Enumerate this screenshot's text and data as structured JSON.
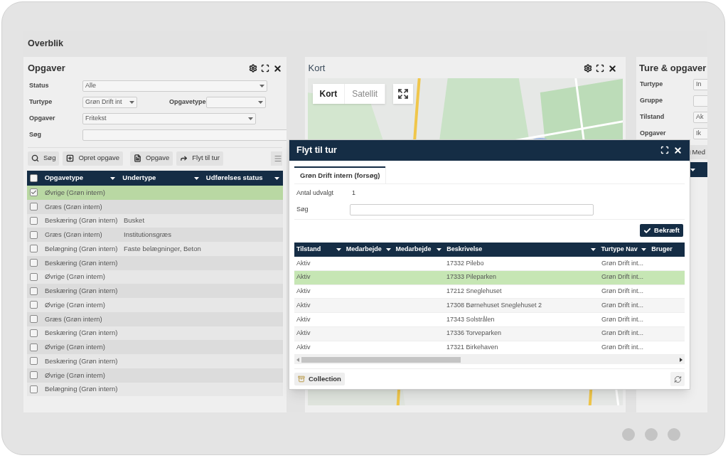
{
  "screen_title": "Overblik",
  "tasks_panel": {
    "title": "Opgaver",
    "filter_rows": [
      {
        "fields": [
          {
            "label": "Status",
            "value": "Alle",
            "kind": "select"
          }
        ]
      },
      {
        "fields": [
          {
            "label": "Turtype",
            "value": "Grøn Drift int",
            "kind": "select"
          },
          {
            "label": "Opgavetype",
            "kind": "select"
          }
        ]
      },
      {
        "fields": [
          {
            "label": "Opgaver",
            "value": "Fritekst",
            "kind": "select"
          }
        ]
      },
      {
        "fields": [
          {
            "label": "Søg",
            "kind": "text"
          }
        ]
      }
    ],
    "toolbar": [
      "Søg",
      "Opret opgave",
      "Opgave",
      "Flyt til tur"
    ],
    "columns": [
      "Opgavetype",
      "Undertype",
      "Udførelses status"
    ],
    "all_checked": false,
    "rows": [
      {
        "opgavetype": "Øvrige (Grøn intern)",
        "checked": true,
        "selected": true
      },
      {
        "opgavetype": "Græs (Grøn intern)",
        "checked": false,
        "selected": false
      },
      {
        "opgavetype": "Beskæring (Grøn intern)",
        "undertype": "Busket",
        "checked": false,
        "selected": false
      },
      {
        "opgavetype": "Græs (Grøn intern)",
        "undertype": "Institutionsgræs",
        "checked": false,
        "selected": false
      },
      {
        "opgavetype": "Belægning (Grøn intern)",
        "undertype": "Faste belægninger, Beton",
        "checked": false,
        "selected": false
      },
      {
        "opgavetype": "Beskæring (Grøn intern)",
        "checked": false,
        "selected": false
      },
      {
        "opgavetype": "Øvrige (Grøn intern)",
        "checked": false,
        "selected": false
      },
      {
        "opgavetype": "Beskæring (Grøn intern)",
        "checked": false,
        "selected": false
      },
      {
        "opgavetype": "Øvrige (Grøn intern)",
        "checked": false,
        "selected": false
      },
      {
        "opgavetype": "Græs (Grøn intern)",
        "checked": false,
        "selected": false
      },
      {
        "opgavetype": "Beskæring (Grøn intern)",
        "checked": false,
        "selected": false
      },
      {
        "opgavetype": "Øvrige (Grøn intern)",
        "checked": false,
        "selected": false
      },
      {
        "opgavetype": "Beskæring (Grøn intern)",
        "checked": false,
        "selected": false
      },
      {
        "opgavetype": "Øvrige (Grøn intern)",
        "checked": false,
        "selected": false
      },
      {
        "opgavetype": "Belægning (Grøn intern)",
        "checked": false,
        "selected": false
      }
    ]
  },
  "map_panel": {
    "title": "Kort",
    "map_types": [
      {
        "label": "Kort",
        "selected": true
      },
      {
        "label": "Satellit",
        "selected": false
      }
    ]
  },
  "trips_panel": {
    "title": "Ture & opgaver",
    "filters": [
      {
        "label": "Turtype",
        "value": "In"
      },
      {
        "label": "Gruppe"
      },
      {
        "label": "Tilstand",
        "value": "Ak"
      },
      {
        "label": "Opgaver",
        "value": "Ik"
      }
    ],
    "toolbar": [
      "Med"
    ]
  },
  "dialog": {
    "title": "Flyt til tur",
    "tabs": [
      {
        "label": "Grøn Drift intern (forsøg)",
        "selected": true
      }
    ],
    "count_label": "Antal udvalgt",
    "count_value": "1",
    "search_label": "Søg",
    "confirm": "Bekræft",
    "columns": [
      "Tilstand",
      "Medarbejde",
      "Medarbejde",
      "Beskrivelse",
      "Turtype Nav",
      "Bruger"
    ],
    "rows": [
      {
        "tilstand": "Aktiv",
        "beskrivelse": "17332 Pilebo",
        "turtype": "Grøn Drift int...",
        "selected": false
      },
      {
        "tilstand": "Aktiv",
        "beskrivelse": "17333 Pileparken",
        "turtype": "Grøn Drift int...",
        "selected": true
      },
      {
        "tilstand": "Aktiv",
        "beskrivelse": "17212 Sneglehuset",
        "turtype": "Grøn Drift int...",
        "selected": false
      },
      {
        "tilstand": "Aktiv",
        "beskrivelse": "17308 Børnehuset Sneglehuset 2",
        "turtype": "Grøn Drift int...",
        "selected": false
      },
      {
        "tilstand": "Aktiv",
        "beskrivelse": "17343 Solstrålen",
        "turtype": "Grøn Drift int...",
        "selected": false
      },
      {
        "tilstand": "Aktiv",
        "beskrivelse": "17336 Torveparken",
        "turtype": "Grøn Drift int...",
        "selected": false
      },
      {
        "tilstand": "Aktiv",
        "beskrivelse": "17321 Birkehaven",
        "turtype": "Grøn Drift int...",
        "selected": false
      }
    ],
    "footer_button": "Collection"
  }
}
